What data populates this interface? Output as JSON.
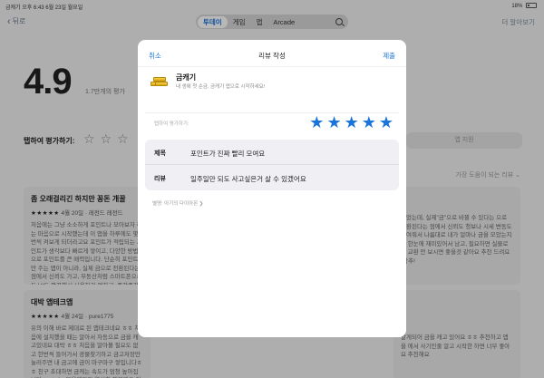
{
  "status_bar": {
    "left": "금캐기  오후 6:43  6월 23일 월요일",
    "right": "18%"
  },
  "nav": {
    "back_label": "뒤로",
    "tabs": [
      "투데이",
      "게임",
      "앱",
      "Arcade"
    ],
    "active_tab": "투데이",
    "more_label": "더 알아보기"
  },
  "background": {
    "score": "4.9",
    "rating_count": "1.7만개의 평가",
    "tap_to_rate": "탭하여 평가하기:",
    "app_support": "앱 지원",
    "sort_label": "가장 도움이 되는 리뷰",
    "reviews": [
      {
        "title": "좀 오래걸리긴 하지만 꽁돈 개꿀",
        "stars": "★★★★★",
        "meta": "4월 20일 · 레전드 레전드",
        "body": "처음에는 그냥 소소하게 포인트나 모아보자 하는 마음으로 시작했는데 이 앱을 하루에도 몇 번씩 켜보게 되더라고요 포인트가 적립되는 포인트가 생각보다 빠르게 쌓이고, 다양한 방법으로 포인트를 큰 매력입니다. 단순히 포인트만 주는 앱이 아니라, 실제 금으로 전환된다는 점에서 신뢰도 가고, 부동산처럼 스마트폰으로도 UI도 깔끔해서 사용하기 편하고, 중간중간 이벤트도..."
      },
      {
        "title": "대박 앱테크앱",
        "stars": "★★★★★",
        "meta": "4월 24일 · pure1775",
        "body": "유의 이해 바로 제대로 된 앱테크네요 ㅎㅎ 처음에 설치했을 때는 알아서 자동으로 금을 캐고있네요 대박 ㅎㅎ 처음을 알아볼 필요도 없고 한번씩 들어가서 광물찾기하고 금고저장만 눌러주면 내 금고에 금이 마구마구 쌓입니다ㅎㅎ 친구 초대하면 금캐는 속도가 엄청 높아집니다ㅎ..ㅎ 1g 모을때까지 열심히 해볼께요 이런어플 정말 감사합니다ㅎㅎ"
      },
      {
        "title": "",
        "stars": "",
        "meta": "",
        "body": "있었는데, 실제\"금\"으로 바뀔 수 있다는 으로 전환된다는 점에서 신뢰도 청보나 시세 변동도 보여줘서 나름대로 내가 얼마나 금을 모았는지도 한눈에 재미있어서 남고, 필요하면 실물로도 교환 만 보시면 좋을것 같아요 추천 드려요 (강추!"
      },
      {
        "title": "",
        "stars": "",
        "meta": "",
        "body": "알게되어 금을 캐고 있어요 ㅎㅎ 추천하고 앱을 에서 사기인줄 알고 시작한 하면 너무 좋아요 추천해요"
      }
    ]
  },
  "review_modal": {
    "cancel_label": "취소",
    "title": "리뷰 작성",
    "submit_label": "제출",
    "app_name": "금캐기",
    "app_subtitle": "내 생애 첫 순금, 금캐기 앱으로 시작하세요!",
    "rate_label": "탭하여 평가하기:",
    "stars": [
      "★",
      "★",
      "★",
      "★",
      "★"
    ],
    "rating": 5,
    "title_field_label": "제목",
    "title_field_value": "포인트가 진짜 빨리 모여요",
    "review_field_label": "리뷰",
    "review_field_value": "일주일만 되도 사고싶은거 살 수 있겠어요",
    "nickname_line": "별명: 아기의 다이아몬 ❯"
  },
  "colors": {
    "accent": "#1b75d8",
    "gold": "#e6b52a"
  }
}
